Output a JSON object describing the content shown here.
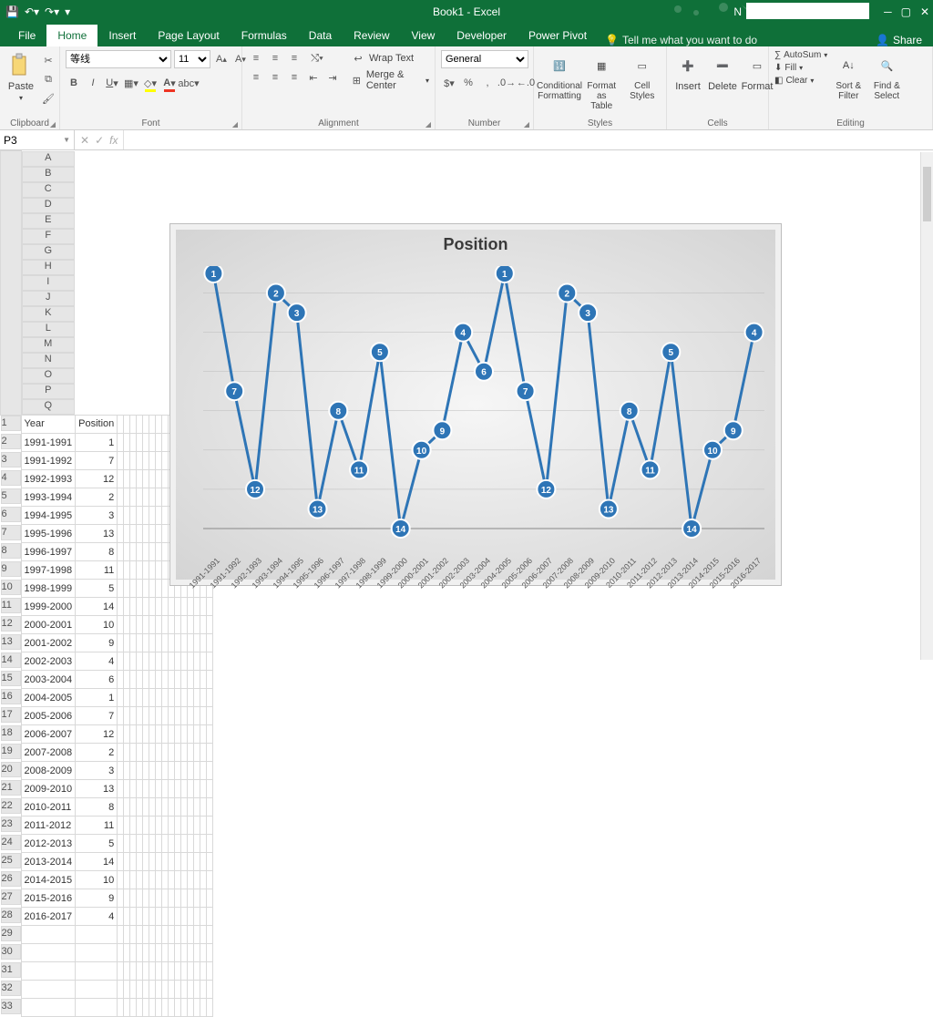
{
  "titlebar": {
    "center": "Book1 - Excel",
    "user_prefix": "N"
  },
  "tabs": {
    "items": [
      "File",
      "Home",
      "Insert",
      "Page Layout",
      "Formulas",
      "Data",
      "Review",
      "View",
      "Developer",
      "Power Pivot"
    ],
    "active": "Home",
    "tellme": "Tell me what you want to do",
    "share": "Share"
  },
  "ribbon": {
    "clipboard": {
      "label": "Clipboard",
      "paste": "Paste"
    },
    "font": {
      "label": "Font",
      "family": "等线",
      "size": "11"
    },
    "alignment": {
      "label": "Alignment",
      "wrap": "Wrap Text",
      "merge": "Merge & Center"
    },
    "number": {
      "label": "Number",
      "format": "General"
    },
    "styles": {
      "label": "Styles",
      "cond": "Conditional Formatting",
      "table": "Format as Table",
      "cell": "Cell Styles"
    },
    "cells": {
      "label": "Cells",
      "insert": "Insert",
      "delete": "Delete",
      "format": "Format"
    },
    "editing": {
      "label": "Editing",
      "autosum": "AutoSum",
      "fill": "Fill",
      "clear": "Clear",
      "sort": "Sort & Filter",
      "find": "Find & Select"
    }
  },
  "fxbar": {
    "name": "P3",
    "fx": "fx"
  },
  "columns": [
    "A",
    "B",
    "C",
    "D",
    "E",
    "F",
    "G",
    "H",
    "I",
    "J",
    "K",
    "L",
    "M",
    "N",
    "O",
    "P",
    "Q"
  ],
  "sheet": {
    "headers": {
      "A": "Year",
      "B": "Position"
    },
    "rows": [
      {
        "n": 1,
        "A": "Year",
        "B": "Position"
      },
      {
        "n": 2,
        "A": "1991-1991",
        "B": "1"
      },
      {
        "n": 3,
        "A": "1991-1992",
        "B": "7"
      },
      {
        "n": 4,
        "A": "1992-1993",
        "B": "12"
      },
      {
        "n": 5,
        "A": "1993-1994",
        "B": "2"
      },
      {
        "n": 6,
        "A": "1994-1995",
        "B": "3"
      },
      {
        "n": 7,
        "A": "1995-1996",
        "B": "13"
      },
      {
        "n": 8,
        "A": "1996-1997",
        "B": "8"
      },
      {
        "n": 9,
        "A": "1997-1998",
        "B": "11"
      },
      {
        "n": 10,
        "A": "1998-1999",
        "B": "5"
      },
      {
        "n": 11,
        "A": "1999-2000",
        "B": "14"
      },
      {
        "n": 12,
        "A": "2000-2001",
        "B": "10"
      },
      {
        "n": 13,
        "A": "2001-2002",
        "B": "9"
      },
      {
        "n": 14,
        "A": "2002-2003",
        "B": "4"
      },
      {
        "n": 15,
        "A": "2003-2004",
        "B": "6"
      },
      {
        "n": 16,
        "A": "2004-2005",
        "B": "1"
      },
      {
        "n": 17,
        "A": "2005-2006",
        "B": "7"
      },
      {
        "n": 18,
        "A": "2006-2007",
        "B": "12"
      },
      {
        "n": 19,
        "A": "2007-2008",
        "B": "2"
      },
      {
        "n": 20,
        "A": "2008-2009",
        "B": "3"
      },
      {
        "n": 21,
        "A": "2009-2010",
        "B": "13"
      },
      {
        "n": 22,
        "A": "2010-2011",
        "B": "8"
      },
      {
        "n": 23,
        "A": "2011-2012",
        "B": "11"
      },
      {
        "n": 24,
        "A": "2012-2013",
        "B": "5"
      },
      {
        "n": 25,
        "A": "2013-2014",
        "B": "14"
      },
      {
        "n": 26,
        "A": "2014-2015",
        "B": "10"
      },
      {
        "n": 27,
        "A": "2015-2016",
        "B": "9"
      },
      {
        "n": 28,
        "A": "2016-2017",
        "B": "4"
      }
    ],
    "blank_rows": [
      29,
      30,
      31,
      32,
      33
    ]
  },
  "chart_data": {
    "type": "line",
    "title": "Position",
    "categories": [
      "1991-1991",
      "1991-1992",
      "1992-1993",
      "1993-1994",
      "1994-1995",
      "1995-1996",
      "1996-1997",
      "1997-1998",
      "1998-1999",
      "1999-2000",
      "2000-2001",
      "2001-2002",
      "2002-2003",
      "2003-2004",
      "2004-2005",
      "2005-2006",
      "2006-2007",
      "2007-2008",
      "2008-2009",
      "2009-2010",
      "2010-2011",
      "2011-2012",
      "2012-2013",
      "2013-2014",
      "2014-2015",
      "2015-2016",
      "2016-2017"
    ],
    "values": [
      1,
      7,
      12,
      2,
      3,
      13,
      8,
      11,
      5,
      14,
      10,
      9,
      4,
      6,
      1,
      7,
      12,
      2,
      3,
      13,
      8,
      11,
      5,
      14,
      10,
      9,
      4
    ],
    "ylim": [
      1,
      14
    ],
    "marker_color": "#2E75B6",
    "line_color": "#2E75B6",
    "data_labels": true
  }
}
